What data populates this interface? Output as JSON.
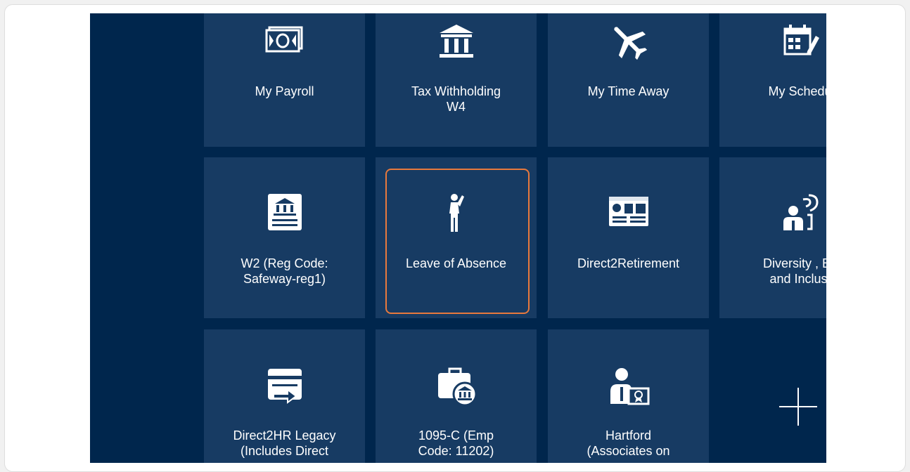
{
  "springboard": {
    "row1": [
      {
        "label_1": "My Payroll",
        "label_2": "",
        "icon": "money-icon"
      },
      {
        "label_1": "Tax Withholding",
        "label_2": "W4",
        "icon": "bank-icon"
      },
      {
        "label_1": "My Time Away",
        "label_2": "",
        "icon": "airplane-icon"
      },
      {
        "label_1": "My Schedu",
        "label_2": "",
        "icon": "calendar-edit-icon"
      }
    ],
    "row2": [
      {
        "label_1": "W2 (Reg Code:",
        "label_2": "Safeway-reg1)",
        "icon": "tax-document-icon"
      },
      {
        "label_1": "Leave of Absence",
        "label_2": "",
        "icon": "person-waving-icon"
      },
      {
        "label_1": "Direct2Retirement",
        "label_2": "",
        "icon": "dashboard-card-icon"
      },
      {
        "label_1": "Diversity , Ec",
        "label_2": "and Inclusi",
        "icon": "people-speaking-icon"
      }
    ],
    "row3": [
      {
        "label_1": "Direct2HR Legacy",
        "label_2": "(Includes Direct",
        "icon": "card-transfer-icon"
      },
      {
        "label_1": "1095-C (Emp",
        "label_2": "Code: 11202)",
        "icon": "briefcase-bank-icon"
      },
      {
        "label_1": "Hartford",
        "label_2": "(Associates on",
        "icon": "person-certificate-icon"
      }
    ],
    "add_tile": {
      "icon": "plus-icon"
    }
  },
  "colors": {
    "background": "#00264d",
    "tile": "#173b63",
    "focus_ring": "#e8793d",
    "text": "#ffffff"
  }
}
